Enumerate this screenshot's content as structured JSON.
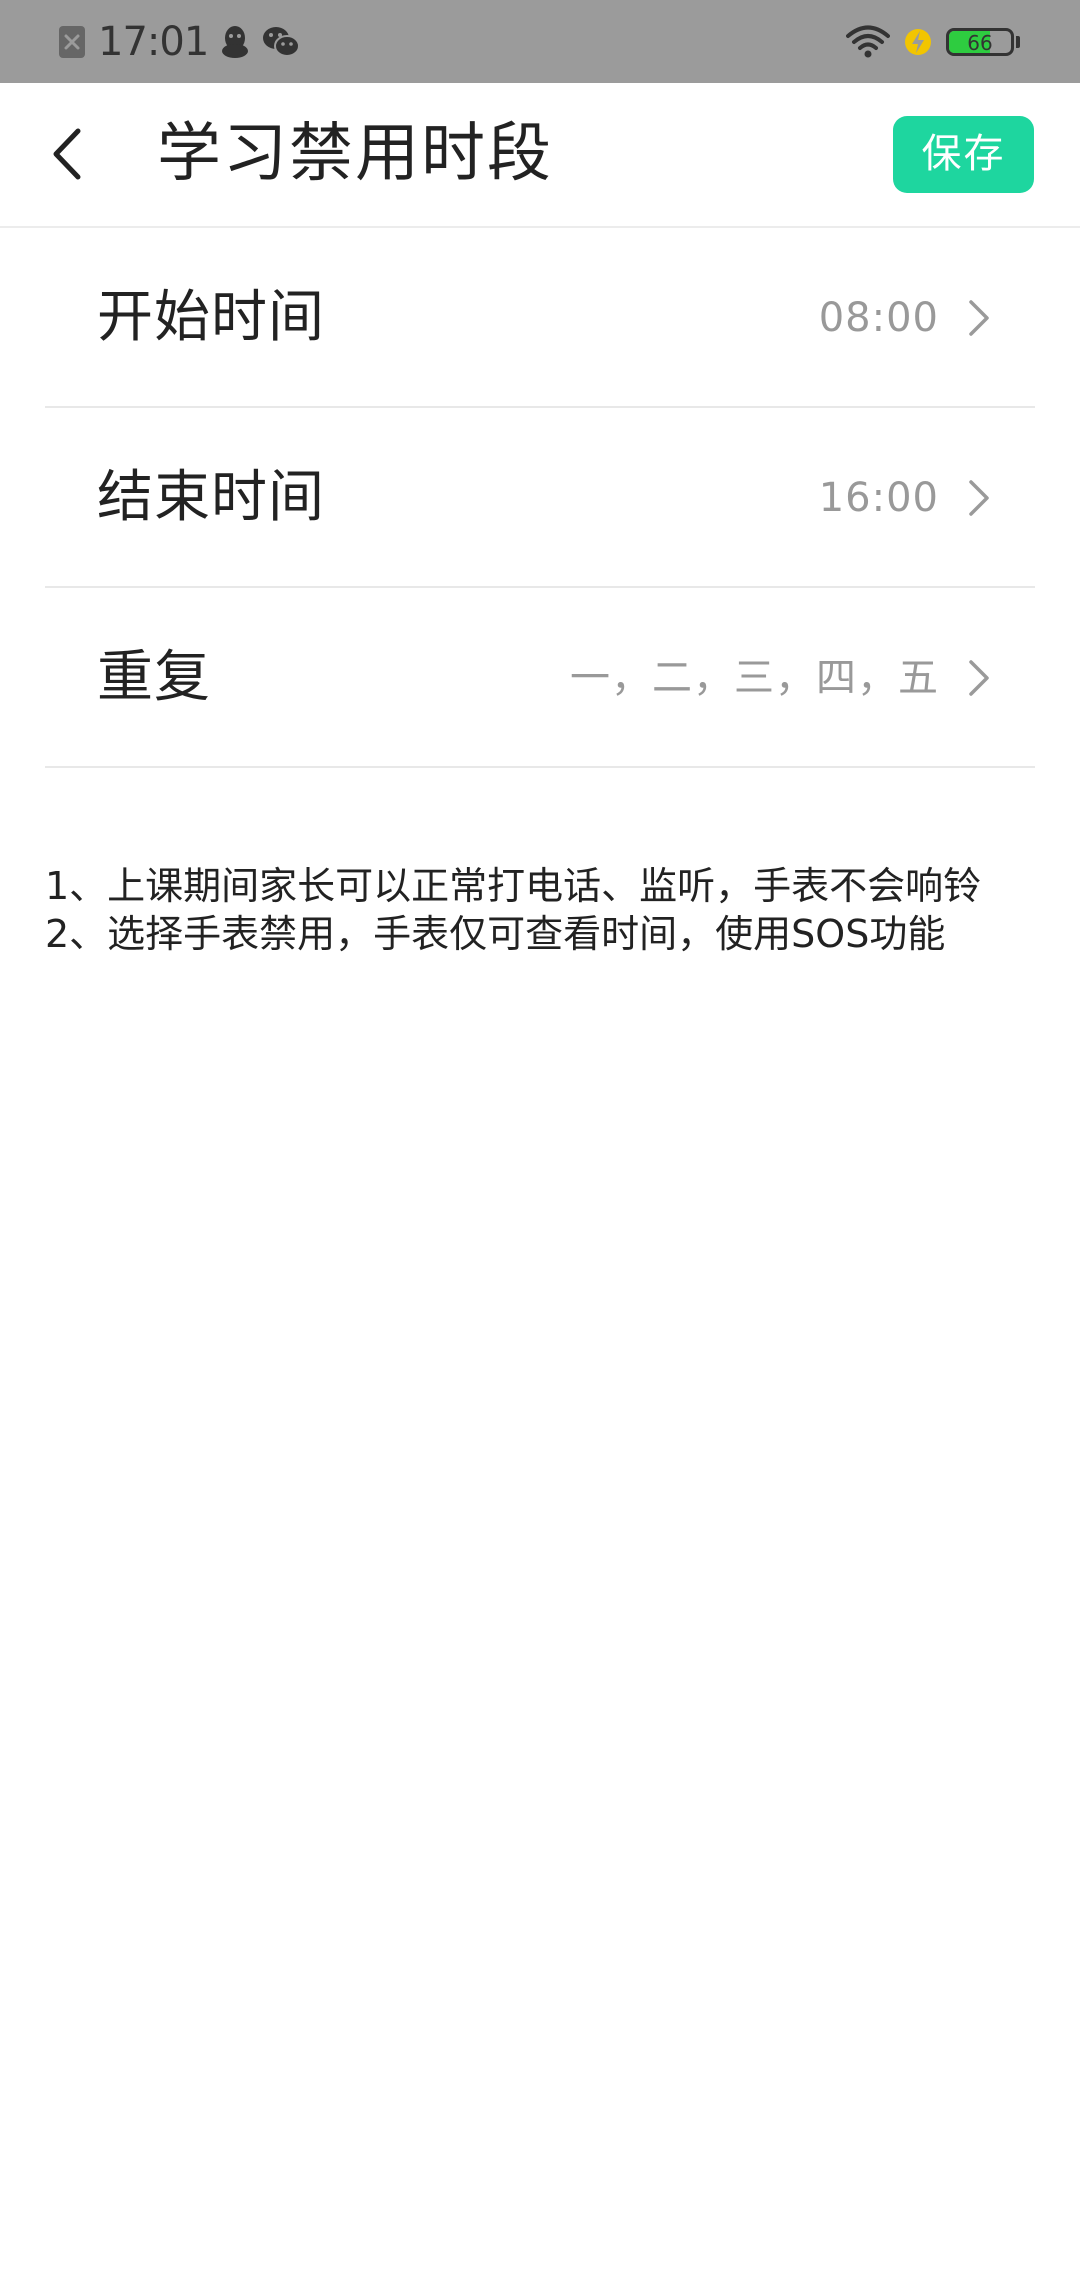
{
  "status_bar": {
    "time": "17:01",
    "battery_level": "66",
    "battery_percent": 66,
    "icons": [
      "close-icon",
      "qq-icon",
      "wechat-icon",
      "wifi-icon",
      "charging-icon",
      "battery-icon"
    ]
  },
  "header": {
    "title": "学习禁用时段",
    "save_label": "保存",
    "accent_color": "#1ed69f"
  },
  "settings": [
    {
      "label": "开始时间",
      "value": "08:00"
    },
    {
      "label": "结束时间",
      "value": "16:00"
    },
    {
      "label": "重复",
      "value": "一，二，三，四，五"
    }
  ],
  "notes": [
    "1、上课期间家长可以正常打电话、监听，手表不会响铃",
    "2、选择手表禁用，手表仅可查看时间，使用SOS功能"
  ]
}
